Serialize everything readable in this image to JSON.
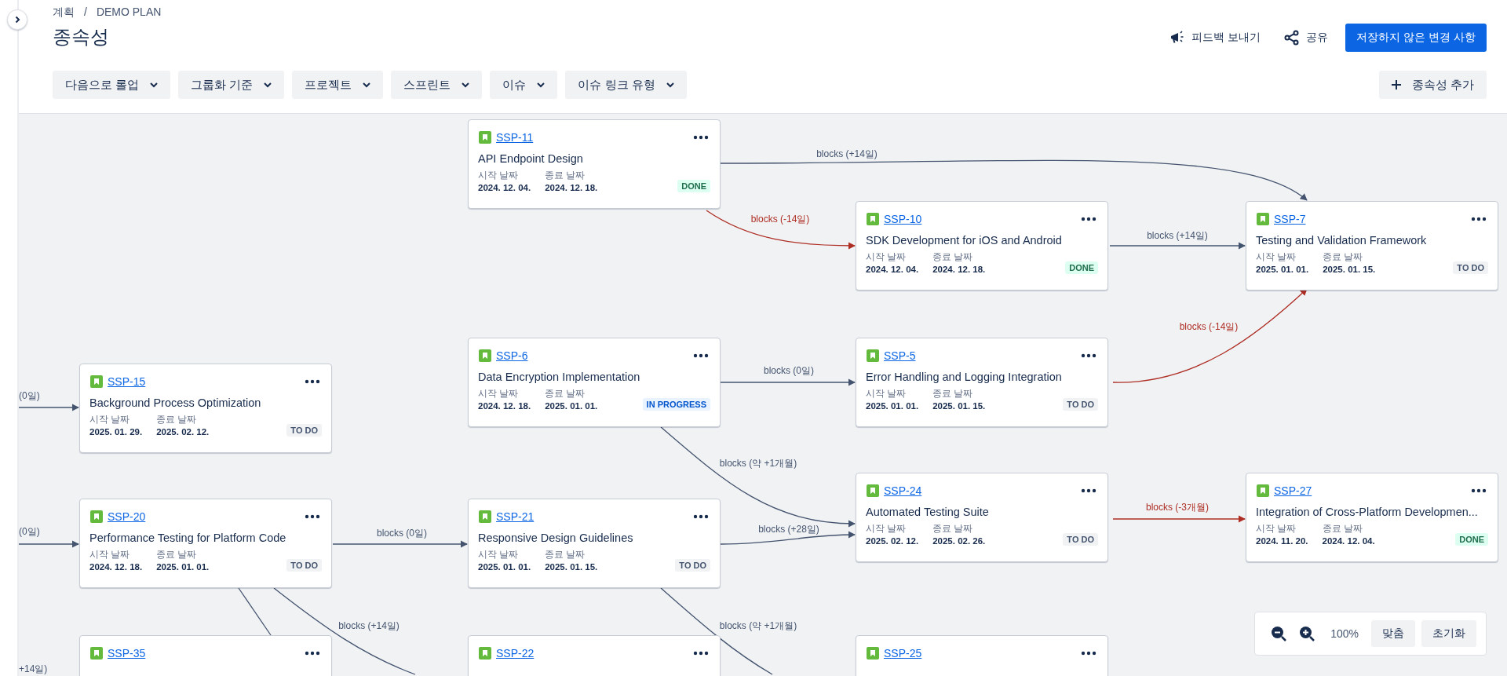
{
  "breadcrumb": [
    "계획",
    "/",
    "DEMO PLAN"
  ],
  "title": "종속성",
  "actions": {
    "feedback": "피드백 보내기",
    "share": "공유",
    "save": "저장하지 않은 변경 사항"
  },
  "filters": [
    "다음으로 롤업",
    "그룹화 기준",
    "프로젝트",
    "스프린트",
    "이슈",
    "이슈 링크 유형"
  ],
  "add_button": "종속성 추가",
  "cards": [
    {
      "key": "SSP-11",
      "title": "API Endpoint Design",
      "start_label": "시작 날짜",
      "start": "2024. 12. 04.",
      "end_label": "종료 날짜",
      "end": "2024. 12. 18.",
      "status": {
        "label": "DONE",
        "kind": "done"
      }
    },
    {
      "key": "SSP-10",
      "title": "SDK Development for iOS and Android",
      "start_label": "시작 날짜",
      "start": "2024. 12. 04.",
      "end_label": "종료 날짜",
      "end": "2024. 12. 18.",
      "status": {
        "label": "DONE",
        "kind": "done"
      }
    },
    {
      "key": "SSP-7",
      "title": "Testing and Validation Framework",
      "start_label": "시작 날짜",
      "start": "2025. 01. 01.",
      "end_label": "종료 날짜",
      "end": "2025. 01. 15.",
      "status": {
        "label": "TO DO",
        "kind": "todo"
      }
    },
    {
      "key": "SSP-6",
      "title": "Data Encryption Implementation",
      "start_label": "시작 날짜",
      "start": "2024. 12. 18.",
      "end_label": "종료 날짜",
      "end": "2025. 01. 01.",
      "status": {
        "label": "IN PROGRESS",
        "kind": "inprogress"
      }
    },
    {
      "key": "SSP-5",
      "title": "Error Handling and Logging Integration",
      "start_label": "시작 날짜",
      "start": "2025. 01. 01.",
      "end_label": "종료 날짜",
      "end": "2025. 01. 15.",
      "status": {
        "label": "TO DO",
        "kind": "todo"
      }
    },
    {
      "key": "SSP-15",
      "title": "Background Process Optimization",
      "start_label": "시작 날짜",
      "start": "2025. 01. 29.",
      "end_label": "종료 날짜",
      "end": "2025. 02. 12.",
      "status": {
        "label": "TO DO",
        "kind": "todo"
      }
    },
    {
      "key": "SSP-24",
      "title": "Automated Testing Suite",
      "start_label": "시작 날짜",
      "start": "2025. 02. 12.",
      "end_label": "종료 날짜",
      "end": "2025. 02. 26.",
      "status": {
        "label": "TO DO",
        "kind": "todo"
      }
    },
    {
      "key": "SSP-27",
      "title": "Integration of Cross-Platform Developmen...",
      "start_label": "시작 날짜",
      "start": "2024. 11. 20.",
      "end_label": "종료 날짜",
      "end": "2024. 12. 04.",
      "status": {
        "label": "DONE",
        "kind": "done"
      }
    },
    {
      "key": "SSP-20",
      "title": "Performance Testing for Platform Code",
      "start_label": "시작 날짜",
      "start": "2024. 12. 18.",
      "end_label": "종료 날짜",
      "end": "2025. 01. 01.",
      "status": {
        "label": "TO DO",
        "kind": "todo"
      }
    },
    {
      "key": "SSP-21",
      "title": "Responsive Design Guidelines",
      "start_label": "시작 날짜",
      "start": "2025. 01. 01.",
      "end_label": "종료 날짜",
      "end": "2025. 01. 15.",
      "status": {
        "label": "TO DO",
        "kind": "todo"
      }
    },
    {
      "key": "SSP-35"
    },
    {
      "key": "SSP-22"
    },
    {
      "key": "SSP-25"
    }
  ],
  "links": [
    {
      "label": "blocks (+14일)",
      "color": "#44546f"
    },
    {
      "label": "blocks (-14일)",
      "color": "#ae2e24"
    },
    {
      "label": "blocks (+14일)",
      "color": "#44546f"
    },
    {
      "label": "blocks (-14일)",
      "color": "#ae2e24"
    },
    {
      "label": "blocks (0일)",
      "color": "#44546f"
    },
    {
      "label": "blocks (약 +1개월)",
      "color": "#44546f"
    },
    {
      "label": "blocks (+28일)",
      "color": "#44546f"
    },
    {
      "label": "blocks (-3개월)",
      "color": "#ae2e24"
    },
    {
      "label": "blocks (0일)",
      "color": "#44546f"
    },
    {
      "label": "blocks (+14일)",
      "color": "#44546f"
    },
    {
      "label": "blocks (약 +1개월)",
      "color": "#44546f"
    },
    {
      "label": "(0일)",
      "color": "#44546f"
    },
    {
      "label": "(0일)",
      "color": "#44546f"
    },
    {
      "label": "+14일)",
      "color": "#44546f"
    }
  ],
  "zoom": {
    "percent": "100%",
    "fit": "맞춤",
    "reset": "초기화"
  }
}
